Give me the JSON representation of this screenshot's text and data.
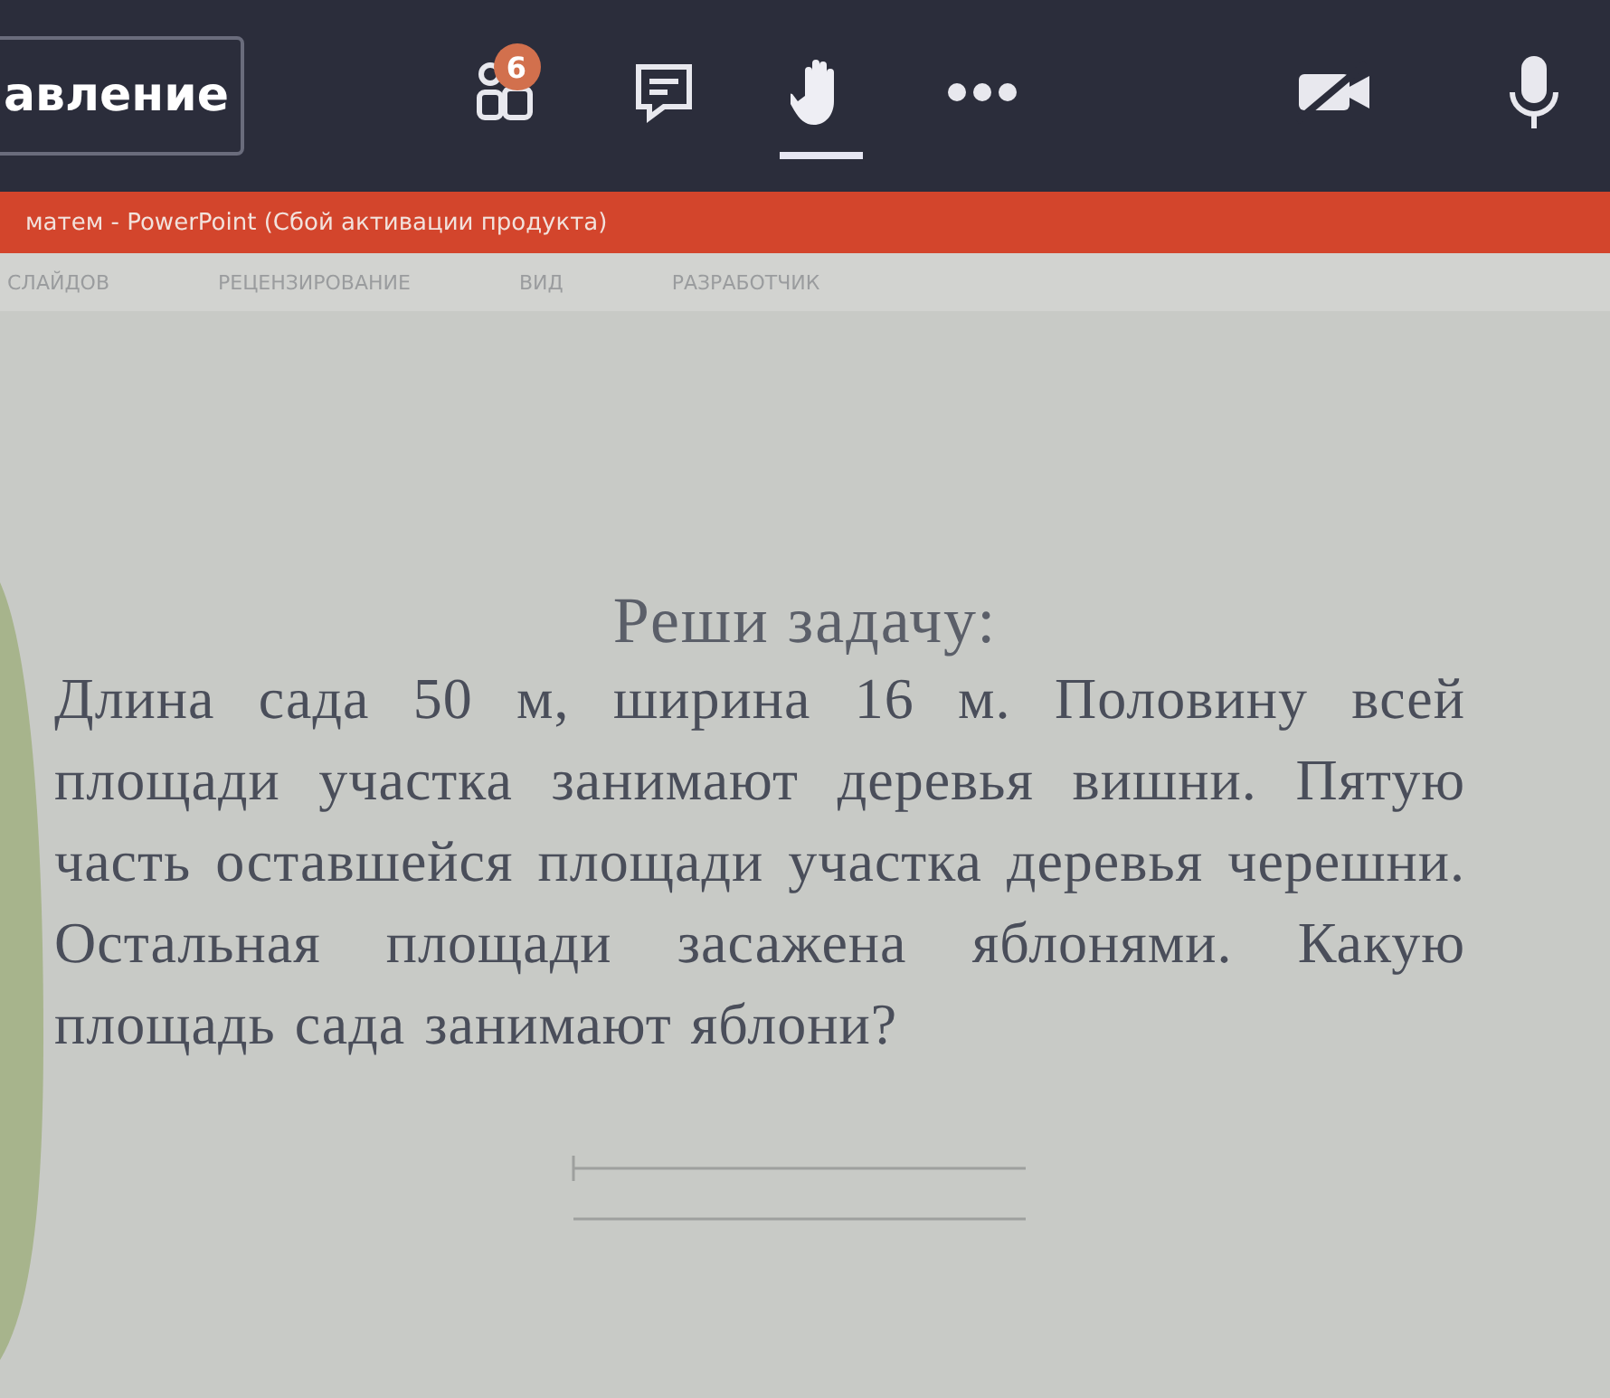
{
  "meeting_bar": {
    "button": "авление",
    "tools": [
      {
        "kind": "people",
        "badge": "6",
        "selected": false
      },
      {
        "kind": "chat",
        "selected": false
      },
      {
        "kind": "hand",
        "selected": true
      },
      {
        "kind": "more",
        "selected": false
      }
    ],
    "media": [
      {
        "kind": "camera",
        "on": false
      },
      {
        "kind": "mic",
        "on": true
      }
    ]
  },
  "title_bar": {
    "title": "матем - PowerPoint (Сбой активации продукта)"
  },
  "ribbon": {
    "tabs": [
      "СЛАЙДОВ",
      "РЕЦЕНЗИРОВАНИЕ",
      "ВИД",
      "РАЗРАБОТЧИК"
    ]
  },
  "slide": {
    "heading": "Реши задачу:",
    "text": "Длина сада 50 м, ширина 16 м. Половину всей площади участка занимают деревья вишни. Пятую часть оставшейся площади участка деревья черешни. Остальная площади засажена яблонями. Какую площадь сада занимают яблони?"
  }
}
